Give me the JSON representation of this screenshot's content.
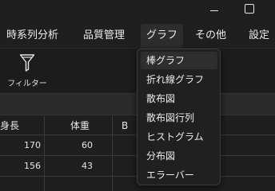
{
  "menubar": {
    "items": [
      "時系列分析",
      "品質管理",
      "グラフ",
      "その他",
      "設定"
    ]
  },
  "ribbon": {
    "filter_label": "フィルター"
  },
  "table": {
    "columns": [
      "身長",
      "体重",
      "B"
    ],
    "rows": [
      [
        "170",
        "60"
      ],
      [
        "156",
        "43"
      ]
    ]
  },
  "graph_menu": {
    "items": [
      "棒グラフ",
      "折れ線グラフ",
      "散布図",
      "散布図行列",
      "ヒストグラム",
      "分布図",
      "エラーバー"
    ],
    "highlighted": "棒グラフ"
  },
  "icons": {
    "filter": "funnel-icon",
    "minimize": "minimize-icon",
    "maximize": "maximize-icon"
  }
}
